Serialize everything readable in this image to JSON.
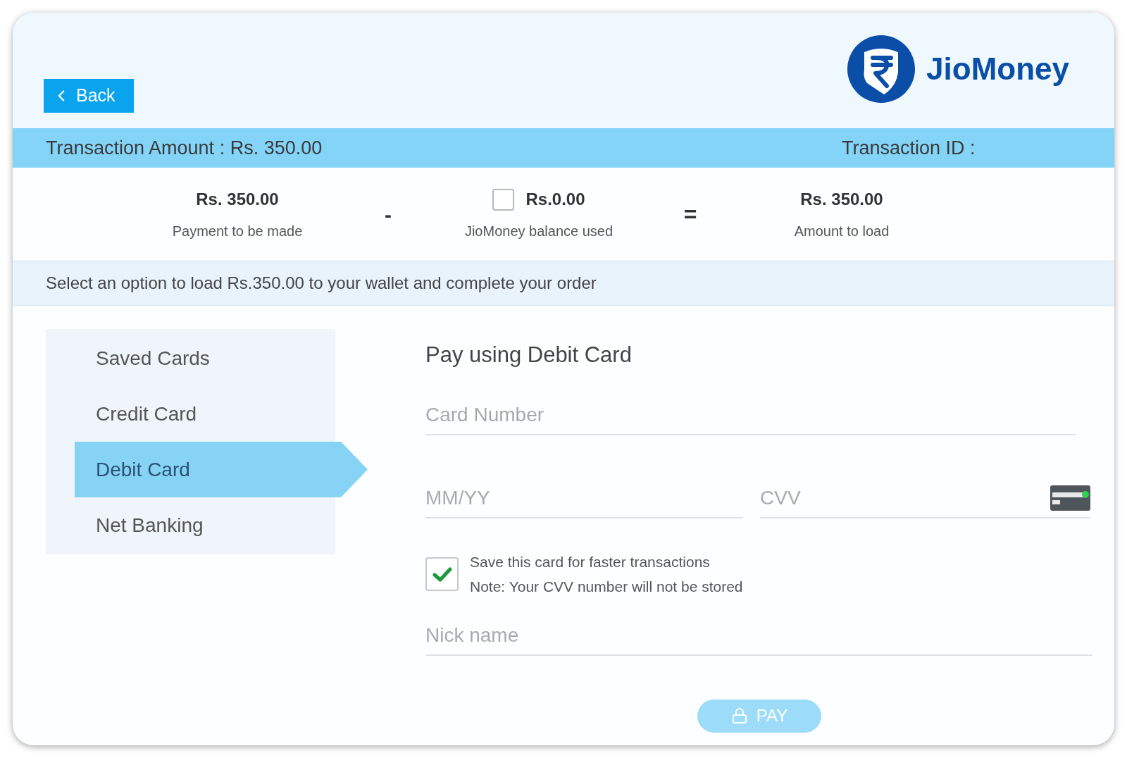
{
  "header": {
    "back_button": "Back",
    "brand": "JioMoney"
  },
  "transaction_bar": {
    "amount": "Transaction Amount : Rs. 350.00",
    "id_label": "Transaction ID :"
  },
  "summary": {
    "payment": {
      "value": "Rs. 350.00",
      "label": "Payment to be made"
    },
    "minus": "-",
    "balance": {
      "value": "Rs.0.00",
      "label": "JioMoney balance used",
      "checked": false
    },
    "equals": "=",
    "load": {
      "value": "Rs. 350.00",
      "label": "Amount to load"
    }
  },
  "notice": "Select an option to load Rs.350.00 to your wallet and complete your order",
  "payment_options": [
    {
      "label": "Saved Cards",
      "selected": false
    },
    {
      "label": "Credit Card",
      "selected": false
    },
    {
      "label": "Debit Card",
      "selected": true
    },
    {
      "label": "Net Banking",
      "selected": false
    }
  ],
  "form": {
    "title": "Pay using Debit Card",
    "card_number": {
      "placeholder": "Card Number"
    },
    "expiry": {
      "placeholder": "MM/YY"
    },
    "cvv": {
      "placeholder": "CVV"
    },
    "save_card": {
      "checked": true,
      "label": "Save this card for faster transactions",
      "note": "Note: Your CVV number will not be stored"
    },
    "nick_name": {
      "placeholder": "Nick name"
    },
    "pay_button": "PAY"
  }
}
